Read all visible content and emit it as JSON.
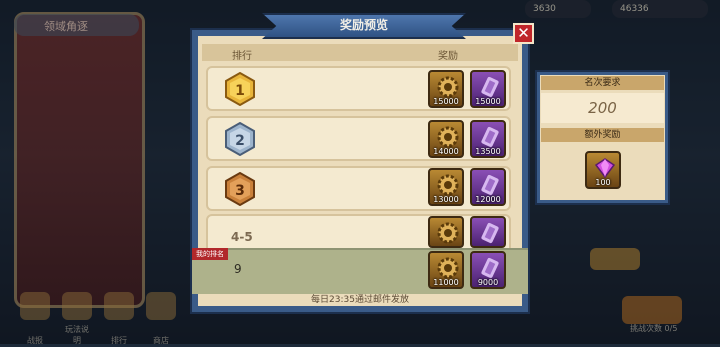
{
  "background": {
    "left_title": "领域角逐",
    "currency_1": "3630",
    "currency_2": "46336",
    "bottom_labels": [
      "战报",
      "玩法说明",
      "排行",
      "商店"
    ],
    "status_text": "挑战次数",
    "count_text": "0/5"
  },
  "dialog": {
    "title": "奖励预览",
    "close_label": "✕",
    "header_rank": "排行",
    "header_reward": "奖励",
    "rows": [
      {
        "rank": "1",
        "rewards": [
          {
            "type": "gold-gear",
            "qty": "15000"
          },
          {
            "type": "purple-scroll",
            "qty": "15000"
          }
        ]
      },
      {
        "rank": "2",
        "rewards": [
          {
            "type": "gold-gear",
            "qty": "14000"
          },
          {
            "type": "purple-scroll",
            "qty": "13500"
          }
        ]
      },
      {
        "rank": "3",
        "rewards": [
          {
            "type": "gold-gear",
            "qty": "13000"
          },
          {
            "type": "purple-scroll",
            "qty": "12000"
          }
        ]
      },
      {
        "rank": "4-5",
        "rewards": [
          {
            "type": "gold-gear",
            "qty": ""
          },
          {
            "type": "purple-scroll",
            "qty": ""
          }
        ]
      }
    ],
    "my_rank_label": "我的排名",
    "my_rank_value": "9",
    "my_rank_rewards": [
      {
        "type": "gold-gear",
        "qty": "11000"
      },
      {
        "type": "purple-scroll",
        "qty": "9000"
      }
    ],
    "footer": "每日23:35通过邮件发放"
  },
  "side_panel": {
    "requirement_label": "名次要求",
    "requirement_value": "200",
    "extra_label": "额外奖励",
    "extra_reward": {
      "type": "gem",
      "qty": "100"
    }
  },
  "colors": {
    "dialog_frame": "#3a5b88",
    "parchment": "#ebdcbb",
    "gold_item": "#b98933",
    "purple_item": "#8a4fb5",
    "my_rank_tag": "#b1282b"
  }
}
